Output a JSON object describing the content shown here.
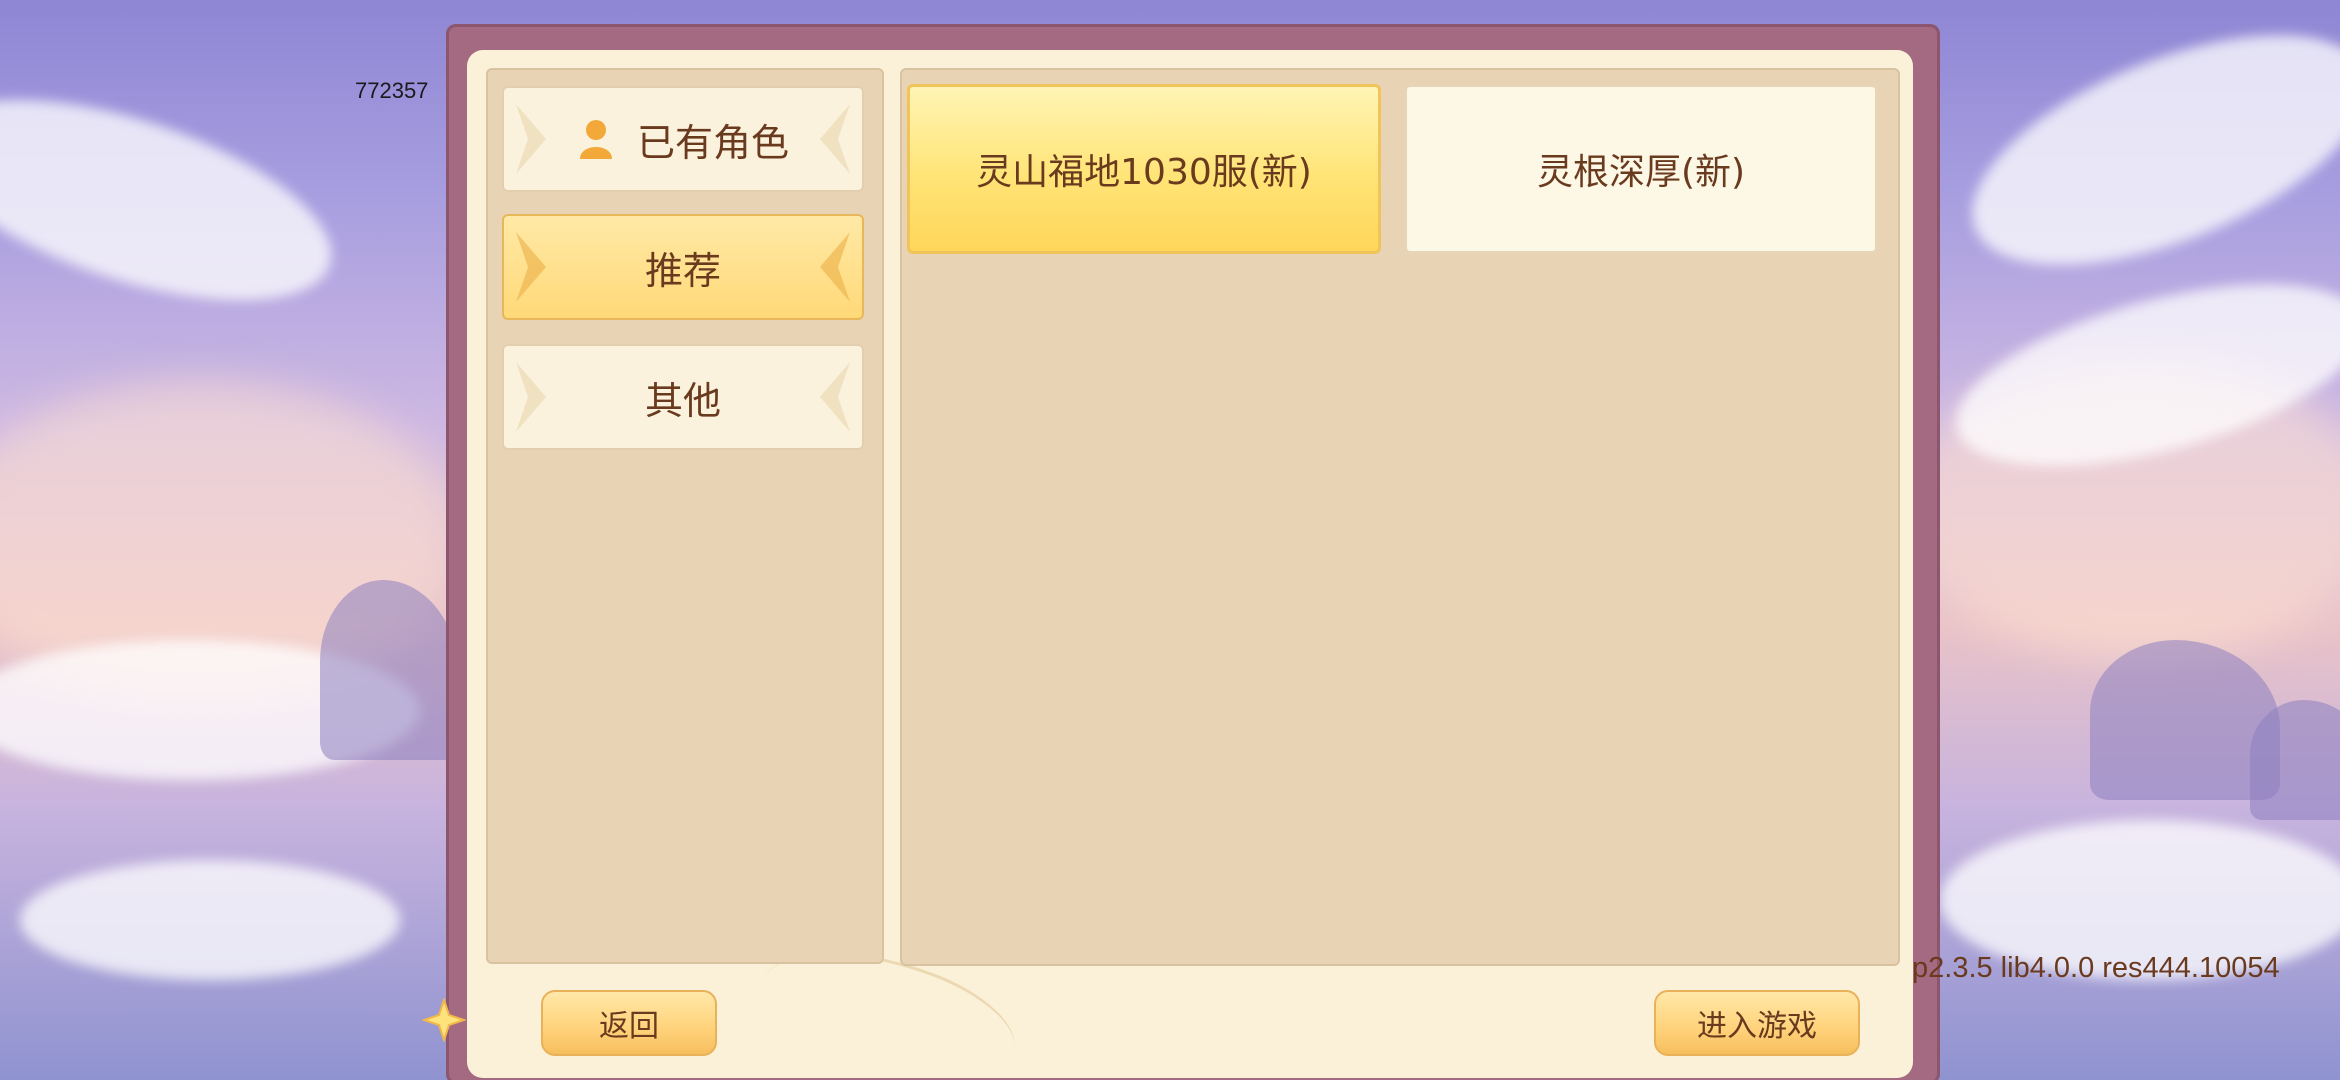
{
  "overlay": {
    "top_left_number": "772357",
    "version": "p2.3.5 lib4.0.0 res444.10054"
  },
  "sidebar": {
    "items": [
      {
        "label": "已有角色",
        "icon": "user-icon",
        "active": false
      },
      {
        "label": "推荐",
        "active": true
      },
      {
        "label": "其他",
        "active": false
      }
    ]
  },
  "servers": [
    {
      "name": "灵山福地1030服(新)",
      "selected": true
    },
    {
      "name": "灵根深厚(新)",
      "selected": false
    }
  ],
  "footer": {
    "back_label": "返回",
    "enter_label": "进入游戏"
  },
  "colors": {
    "frame": "#a46a82",
    "panel": "#fbf1d9",
    "inset": "#e8d3b5",
    "selected": "#ffe476",
    "text": "#6a3a1e"
  }
}
